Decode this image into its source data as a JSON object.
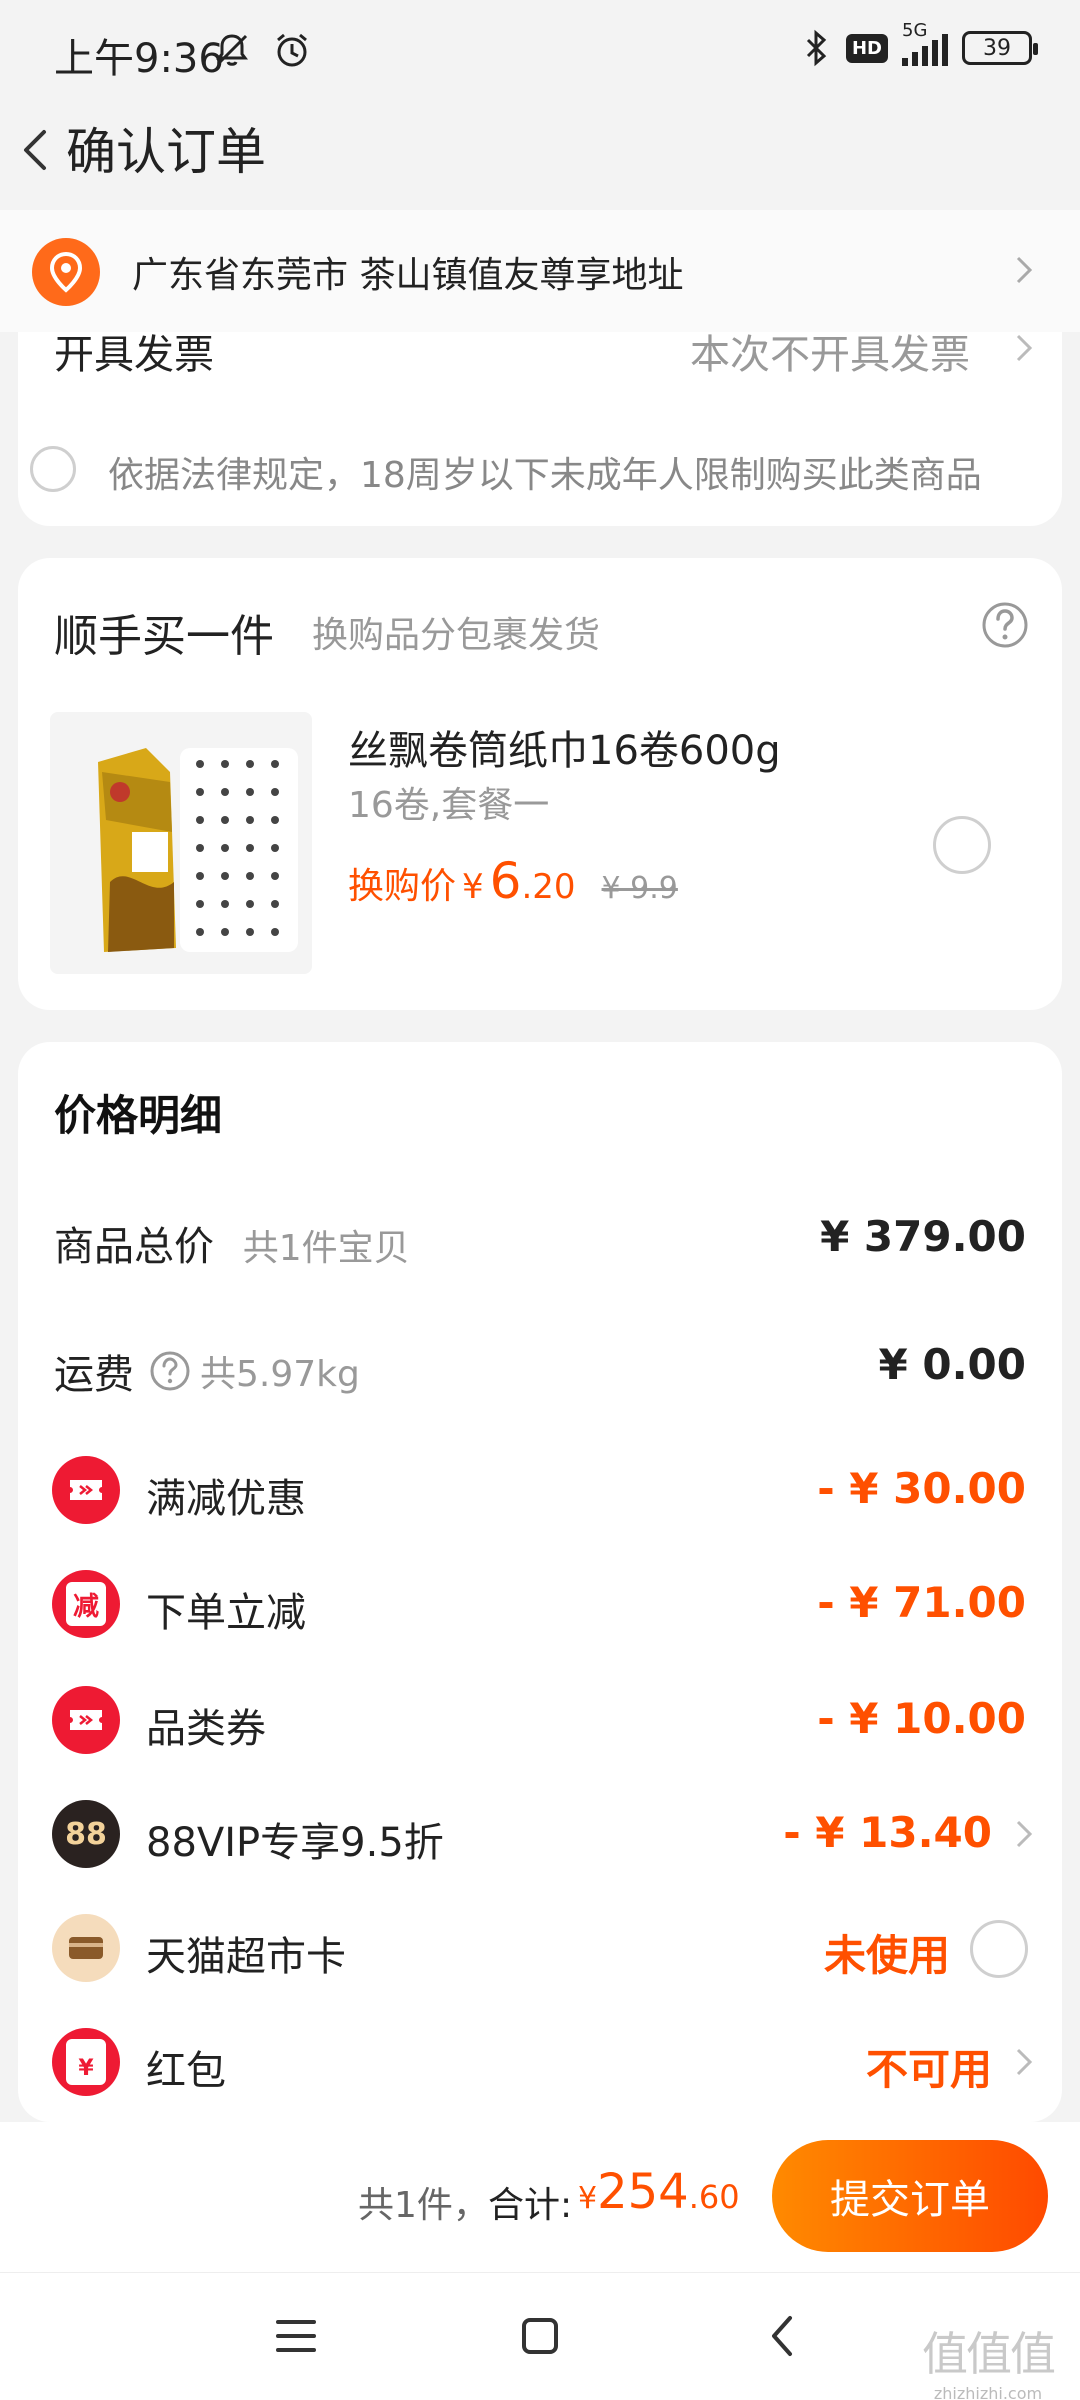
{
  "status_bar": {
    "time": "上午9:36",
    "network": "5G",
    "hd": "HD",
    "battery": "39"
  },
  "header": {
    "title": "确认订单"
  },
  "address": {
    "text": "广东省东莞市 茶山镇值友尊享地址"
  },
  "invoice": {
    "label": "开具发票",
    "value": "本次不开具发票"
  },
  "legal_notice": "依据法律规定，18周岁以下未成年人限制购买此类商品",
  "addon": {
    "title": "顺手买一件",
    "subtitle": "换购品分包裹发货",
    "product": {
      "name": "丝飘卷筒纸巾16卷600g",
      "spec": "16卷,套餐一",
      "price_label": "换购价",
      "currency": "¥",
      "price_int": "6",
      "price_dec": ".20",
      "original_price": "¥ 9.9",
      "selected": false
    }
  },
  "price_detail": {
    "title": "价格明细",
    "subtotal": {
      "label": "商品总价",
      "sub": "共1件宝贝",
      "value": "¥ 379.00"
    },
    "shipping": {
      "label": "运费",
      "sub": "共5.97kg",
      "value": "¥ 0.00"
    },
    "discounts": [
      {
        "label": "满减优惠",
        "value": "- ¥ 30.00",
        "icon": "ticket-icon"
      },
      {
        "label": "下单立减",
        "value": "- ¥ 71.00",
        "icon": "reduce-icon",
        "icon_text": "减"
      },
      {
        "label": "品类券",
        "value": "- ¥ 10.00",
        "icon": "ticket-icon"
      },
      {
        "label": "88VIP专享9.5折",
        "value": "- ¥ 13.40",
        "icon": "vip88-icon",
        "icon_text": "88"
      },
      {
        "label": "天猫超市卡",
        "value": "未使用",
        "icon": "card-icon"
      },
      {
        "label": "红包",
        "value": "不可用",
        "icon": "red-packet-icon",
        "icon_text": "¥"
      }
    ]
  },
  "footer": {
    "count": "共1件，",
    "total_label": "合计:",
    "currency": "¥",
    "total_int": "254",
    "total_dec": ".60",
    "submit_label": "提交订单"
  },
  "watermark": {
    "glyphs": "值值值",
    "url": "zhizhizhi.com"
  },
  "colors": {
    "accent": "#ff5000",
    "button_start": "#ff8a00",
    "button_end": "#ff4a00",
    "background": "#f3f3f3"
  }
}
